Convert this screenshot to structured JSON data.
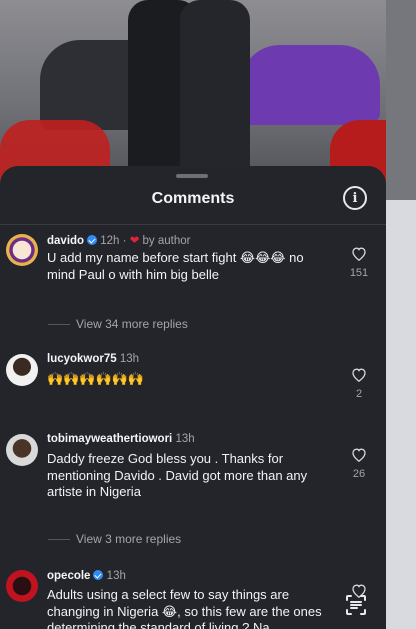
{
  "sheet": {
    "title": "Comments"
  },
  "comments": [
    {
      "username": "davido",
      "time": "12h",
      "by_author": "by author",
      "text": "U add my name before start fight 😂😂😂 no mind Paul o with him big belle",
      "likes": "151",
      "replies": "View 34 more replies"
    },
    {
      "username": "lucyokwor75",
      "time": "13h",
      "text": "🙌🙌🙌🙌🙌🙌",
      "likes": "2"
    },
    {
      "username": "tobimayweathertiowori",
      "time": "13h",
      "text": "Daddy freeze God bless you . Thanks for mentioning Davido . David got more than any artiste in Nigeria",
      "likes": "26",
      "replies": "View 3 more replies"
    },
    {
      "username": "opecole",
      "time": "13h",
      "text": "Adults using a select few to say things are changing in Nigeria 😂, so this few are the ones determining the standard of living ? Na"
    }
  ],
  "icons": {
    "info": "info-icon",
    "like": "heart-outline-icon",
    "verified": "verified-badge-icon",
    "scan": "text-scan-icon"
  },
  "colors": {
    "background": "#24252a",
    "verified": "#2f8cf2",
    "author_heart": "#e0243b"
  }
}
